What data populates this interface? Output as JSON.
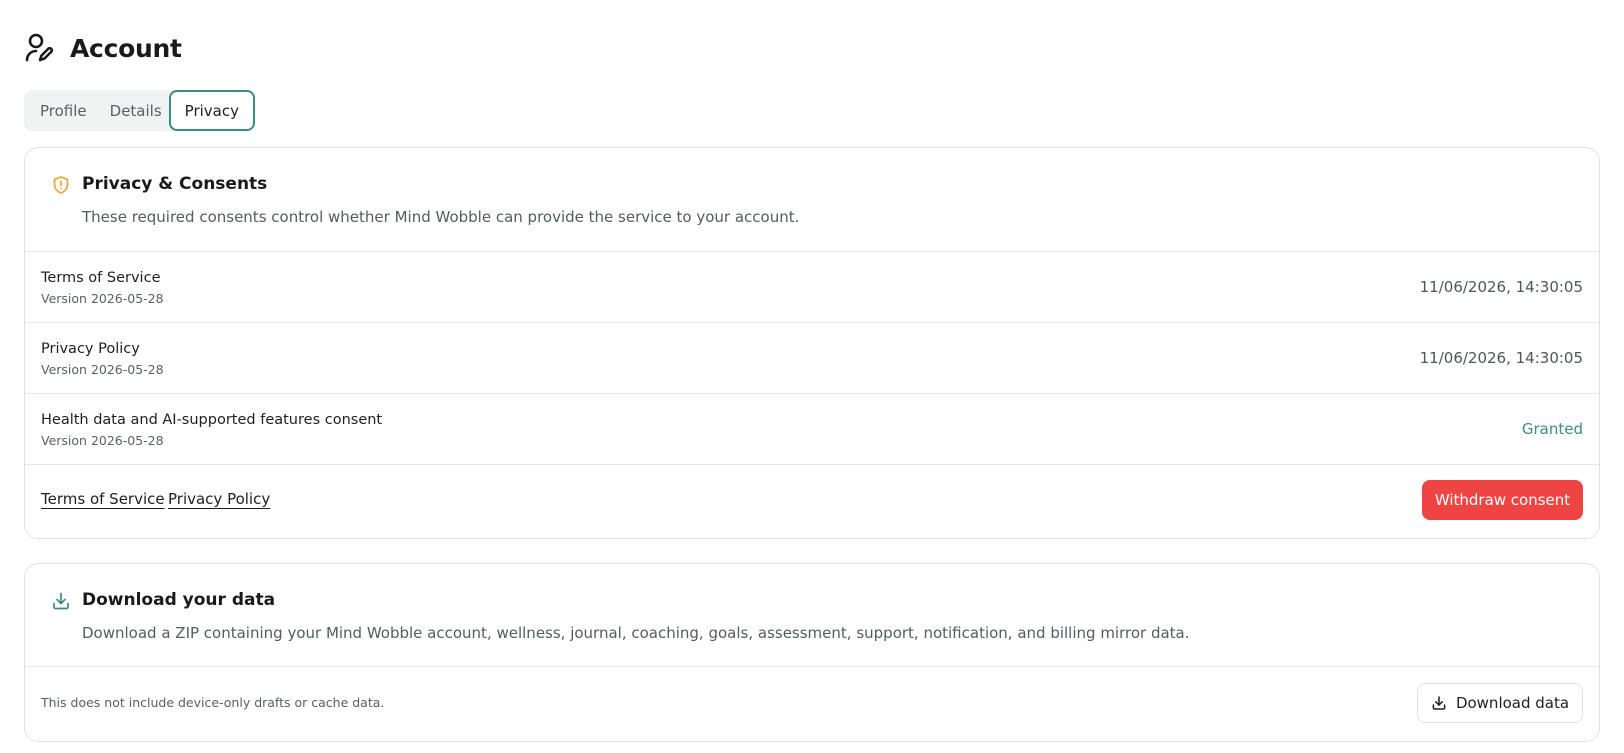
{
  "header": {
    "title": "Account",
    "icon": "user-edit-icon"
  },
  "tabs": [
    {
      "label": "Profile",
      "active": false
    },
    {
      "label": "Details",
      "active": false
    },
    {
      "label": "Privacy",
      "active": true
    }
  ],
  "privacy_card": {
    "icon": "shield-alert-icon",
    "title": "Privacy & Consents",
    "description": "These required consents control whether Mind Wobble can provide the service to your account.",
    "rows": [
      {
        "name": "Terms of Service",
        "version": "Version 2026-05-28",
        "value": "11/06/2026, 14:30:05"
      },
      {
        "name": "Privacy Policy",
        "version": "Version 2026-05-28",
        "value": "11/06/2026, 14:30:05"
      },
      {
        "name": "Health data and AI-supported features consent",
        "version": "Version 2026-05-28",
        "value": "Granted"
      }
    ],
    "links": [
      "Terms of Service",
      "Privacy Policy"
    ],
    "withdraw_label": "Withdraw consent"
  },
  "download_card": {
    "icon": "download-icon",
    "title": "Download your data",
    "description": "Download a ZIP containing your Mind Wobble account, wellness, journal, coaching, goals, assessment, support, notification, and billing mirror data.",
    "note": "This does not include device-only drafts or cache data.",
    "button_label": "Download data"
  },
  "colors": {
    "accent": "#3a8c84",
    "danger": "#ef4444",
    "warning_icon": "#e8a33d"
  }
}
